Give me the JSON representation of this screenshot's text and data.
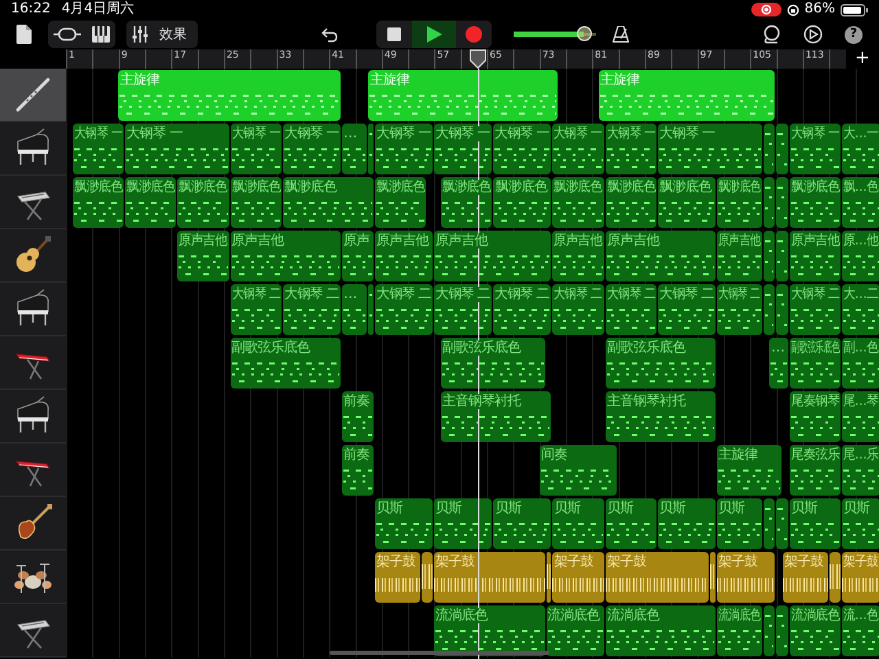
{
  "status_bar": {
    "time": "16:22",
    "date": "4月4日周六",
    "battery": "86%"
  },
  "toolbar": {
    "effects_label": "效果",
    "transport": [
      {
        "kind": "stop",
        "selected": false
      },
      {
        "kind": "play",
        "selected": true
      },
      {
        "kind": "record",
        "selected": false
      }
    ],
    "volume": {
      "level": 0.85
    },
    "help": "?"
  },
  "ruler": {
    "labels": [
      "1",
      "9",
      "17",
      "25",
      "33",
      "41",
      "49",
      "57",
      "65",
      "73",
      "81",
      "89",
      "97",
      "105",
      "113"
    ],
    "add": "+"
  },
  "tracks": [
    {
      "kind": "flute",
      "selected": true,
      "regions": [
        {
          "label": "主旋律"
        },
        {
          "label": "主旋律"
        },
        {
          "label": "主旋律"
        }
      ]
    },
    {
      "kind": "grand-piano",
      "selected": false,
      "regions": [
        {
          "label": "大钢琴 一"
        },
        {
          "label": "大钢琴 一"
        },
        {
          "label": "大钢琴 一"
        },
        {
          "label": "大钢琴 一"
        },
        {
          "label": "…"
        },
        {
          "label": "大钢琴 一"
        },
        {
          "label": "大钢琴 一"
        },
        {
          "label": "大钢琴 一"
        },
        {
          "label": "大钢琴 一"
        },
        {
          "label": "大钢琴 一"
        },
        {
          "label": "大钢琴 一"
        },
        {
          "label": "大钢琴 一"
        },
        {
          "label": "大…一"
        }
      ]
    },
    {
      "kind": "keyboard",
      "selected": false,
      "regions": [
        {
          "label": "飘渺底色"
        },
        {
          "label": "飘渺底色"
        },
        {
          "label": "飘渺底色"
        },
        {
          "label": "飘渺底色"
        },
        {
          "label": "飘渺底色"
        },
        {
          "label": "飘渺底色"
        },
        {
          "label": "飘渺底色"
        },
        {
          "label": "飘渺底色"
        },
        {
          "label": "飘渺底色"
        },
        {
          "label": "飘渺底色"
        },
        {
          "label": "飘渺底色"
        },
        {
          "label": "飘渺底色"
        },
        {
          "label": "飘渺底色"
        },
        {
          "label": "飘…色"
        }
      ]
    },
    {
      "kind": "acoustic-guitar",
      "selected": false,
      "regions": [
        {
          "label": "原声吉他"
        },
        {
          "label": "原声吉他"
        },
        {
          "label": "原声"
        },
        {
          "label": "原声吉他"
        },
        {
          "label": "原声吉他"
        },
        {
          "label": "原声吉他"
        },
        {
          "label": "原声吉他"
        },
        {
          "label": "原声吉他"
        },
        {
          "label": "原声吉他"
        },
        {
          "label": "原…他"
        }
      ]
    },
    {
      "kind": "grand-piano",
      "selected": false,
      "regions": [
        {
          "label": "大钢琴 二"
        },
        {
          "label": "大钢琴 二"
        },
        {
          "label": "…"
        },
        {
          "label": "大钢琴 二"
        },
        {
          "label": "大钢琴 二"
        },
        {
          "label": "大钢琴 二"
        },
        {
          "label": "大钢琴 二"
        },
        {
          "label": "大钢琴 二"
        },
        {
          "label": "大钢琴 二"
        },
        {
          "label": "大钢琴 二"
        },
        {
          "label": "大钢琴 二"
        },
        {
          "label": "大…二"
        }
      ]
    },
    {
      "kind": "synth",
      "selected": false,
      "regions": [
        {
          "label": "副歌弦乐底色"
        },
        {
          "label": "副歌弦乐底色"
        },
        {
          "label": "副歌弦乐底色"
        },
        {
          "label": "…"
        },
        {
          "label": "副歌弦乐底色"
        },
        {
          "label": "副…色"
        }
      ]
    },
    {
      "kind": "grand-piano",
      "selected": false,
      "regions": [
        {
          "label": "前奏"
        },
        {
          "label": "主音钢琴衬托"
        },
        {
          "label": "主音钢琴衬托"
        },
        {
          "label": "尾奏钢琴"
        },
        {
          "label": "尾…琴"
        }
      ]
    },
    {
      "kind": "synth",
      "selected": false,
      "regions": [
        {
          "label": "前奏"
        },
        {
          "label": "间奏"
        },
        {
          "label": "主旋律"
        },
        {
          "label": "尾奏弦乐"
        },
        {
          "label": "尾…乐"
        }
      ]
    },
    {
      "kind": "bass",
      "selected": false,
      "regions": [
        {
          "label": "贝斯"
        },
        {
          "label": "贝斯"
        },
        {
          "label": "贝斯"
        },
        {
          "label": "贝斯"
        },
        {
          "label": "贝斯"
        },
        {
          "label": "贝斯"
        },
        {
          "label": "贝斯"
        },
        {
          "label": "贝斯"
        },
        {
          "label": "贝斯"
        }
      ]
    },
    {
      "kind": "drums",
      "selected": false,
      "regions": [
        {
          "label": "架子鼓"
        },
        {
          "label": "架子鼓"
        },
        {
          "label": "架子鼓"
        },
        {
          "label": "架子鼓"
        },
        {
          "label": "架子鼓"
        },
        {
          "label": "架子鼓"
        },
        {
          "label": "架子鼓"
        }
      ]
    },
    {
      "kind": "keyboard",
      "selected": false,
      "regions": [
        {
          "label": "流淌底色"
        },
        {
          "label": "流淌底色"
        },
        {
          "label": "流淌底色"
        },
        {
          "label": "流淌底色"
        },
        {
          "label": "流淌底色"
        },
        {
          "label": "流…色"
        }
      ]
    }
  ]
}
